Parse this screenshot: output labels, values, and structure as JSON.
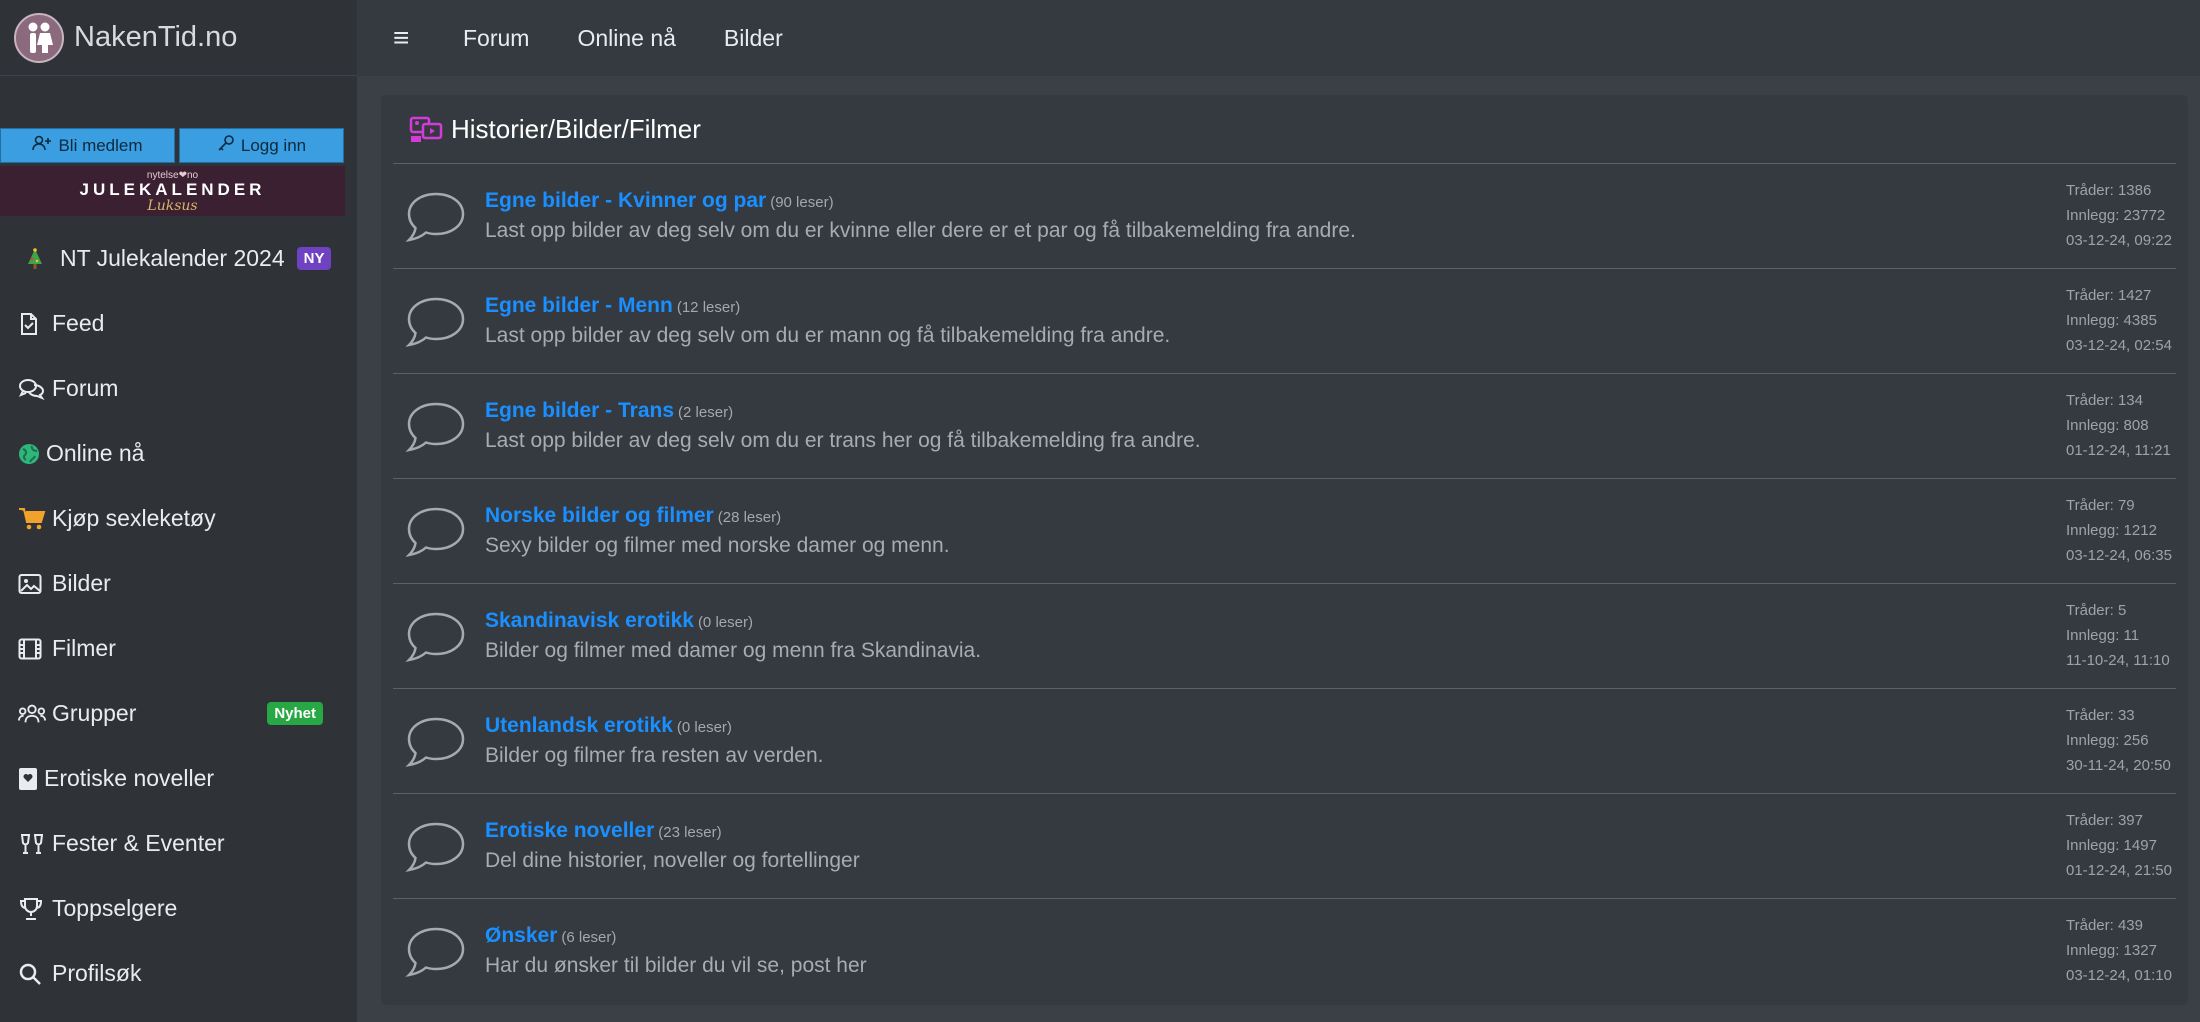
{
  "brand": {
    "name": "NakenTid.no"
  },
  "auth": {
    "member_label": "Bli medlem",
    "login_label": "Logg inn"
  },
  "banner": {
    "top": "nytelse❤no",
    "main": "JULEKALENDER",
    "sub": "Luksus"
  },
  "nav": {
    "julekalender": "NT Julekalender 2024",
    "julekalender_badge": "NY",
    "feed": "Feed",
    "forum": "Forum",
    "online": "Online nå",
    "shop": "Kjøp sexleketøy",
    "bilder": "Bilder",
    "filmer": "Filmer",
    "grupper": "Grupper",
    "grupper_badge": "Nyhet",
    "noveller": "Erotiske noveller",
    "fester": "Fester & Eventer",
    "toppselgere": "Toppselgere",
    "profilsok": "Profilsøk"
  },
  "topnav": {
    "menu_icon": "≡",
    "forum": "Forum",
    "online": "Online nå",
    "bilder": "Bilder"
  },
  "section": {
    "title": "Historier/Bilder/Filmer",
    "forums": [
      {
        "title": "Egne bilder - Kvinner og par",
        "readers": "(90 leser)",
        "desc": "Last opp bilder av deg selv om du er kvinne eller dere er et par og få tilbakemelding fra andre.",
        "threads": "Tråder: 1386",
        "posts": "Innlegg: 23772",
        "last": "03-12-24, 09:22"
      },
      {
        "title": "Egne bilder - Menn",
        "readers": "(12 leser)",
        "desc": "Last opp bilder av deg selv om du er mann og få tilbakemelding fra andre.",
        "threads": "Tråder: 1427",
        "posts": "Innlegg: 4385",
        "last": "03-12-24, 02:54"
      },
      {
        "title": "Egne bilder - Trans",
        "readers": "(2 leser)",
        "desc": "Last opp bilder av deg selv om du er trans her og få tilbakemelding fra andre.",
        "threads": "Tråder: 134",
        "posts": "Innlegg: 808",
        "last": "01-12-24, 11:21"
      },
      {
        "title": "Norske bilder og filmer",
        "readers": "(28 leser)",
        "desc": "Sexy bilder og filmer med norske damer og menn.",
        "threads": "Tråder: 79",
        "posts": "Innlegg: 1212",
        "last": "03-12-24, 06:35"
      },
      {
        "title": "Skandinavisk erotikk",
        "readers": "(0 leser)",
        "desc": "Bilder og filmer med damer og menn fra Skandinavia.",
        "threads": "Tråder: 5",
        "posts": "Innlegg: 11",
        "last": "11-10-24, 11:10"
      },
      {
        "title": "Utenlandsk erotikk",
        "readers": "(0 leser)",
        "desc": "Bilder og filmer fra resten av verden.",
        "threads": "Tråder: 33",
        "posts": "Innlegg: 256",
        "last": "30-11-24, 20:50"
      },
      {
        "title": "Erotiske noveller",
        "readers": "(23 leser)",
        "desc": "Del dine historier, noveller og fortellinger",
        "threads": "Tråder: 397",
        "posts": "Innlegg: 1497",
        "last": "01-12-24, 21:50"
      },
      {
        "title": "Ønsker",
        "readers": "(6 leser)",
        "desc": "Har du ønsker til bilder du vil se, post her",
        "threads": "Tråder: 439",
        "posts": "Innlegg: 1327",
        "last": "03-12-24, 01:10"
      }
    ]
  },
  "colors": {
    "link": "#1a8fff",
    "page_bg": "#3b4047",
    "card_bg": "#343a40",
    "sidebar_bg": "#2f3338"
  }
}
